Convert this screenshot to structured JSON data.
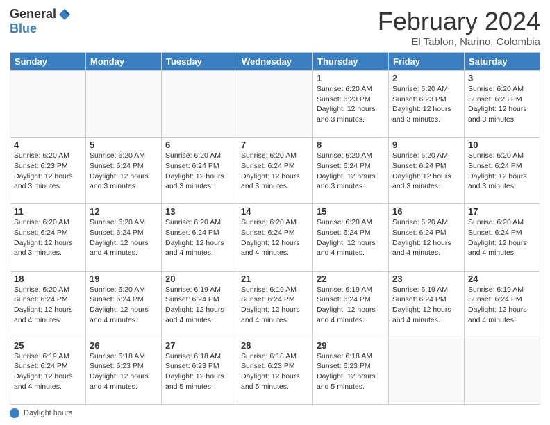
{
  "header": {
    "logo_general": "General",
    "logo_blue": "Blue",
    "month_title": "February 2024",
    "location": "El Tablon, Narino, Colombia"
  },
  "days_of_week": [
    "Sunday",
    "Monday",
    "Tuesday",
    "Wednesday",
    "Thursday",
    "Friday",
    "Saturday"
  ],
  "footer": {
    "label": "Daylight hours"
  },
  "weeks": [
    [
      {
        "num": "",
        "info": ""
      },
      {
        "num": "",
        "info": ""
      },
      {
        "num": "",
        "info": ""
      },
      {
        "num": "",
        "info": ""
      },
      {
        "num": "1",
        "info": "Sunrise: 6:20 AM\nSunset: 6:23 PM\nDaylight: 12 hours\nand 3 minutes."
      },
      {
        "num": "2",
        "info": "Sunrise: 6:20 AM\nSunset: 6:23 PM\nDaylight: 12 hours\nand 3 minutes."
      },
      {
        "num": "3",
        "info": "Sunrise: 6:20 AM\nSunset: 6:23 PM\nDaylight: 12 hours\nand 3 minutes."
      }
    ],
    [
      {
        "num": "4",
        "info": "Sunrise: 6:20 AM\nSunset: 6:23 PM\nDaylight: 12 hours\nand 3 minutes."
      },
      {
        "num": "5",
        "info": "Sunrise: 6:20 AM\nSunset: 6:24 PM\nDaylight: 12 hours\nand 3 minutes."
      },
      {
        "num": "6",
        "info": "Sunrise: 6:20 AM\nSunset: 6:24 PM\nDaylight: 12 hours\nand 3 minutes."
      },
      {
        "num": "7",
        "info": "Sunrise: 6:20 AM\nSunset: 6:24 PM\nDaylight: 12 hours\nand 3 minutes."
      },
      {
        "num": "8",
        "info": "Sunrise: 6:20 AM\nSunset: 6:24 PM\nDaylight: 12 hours\nand 3 minutes."
      },
      {
        "num": "9",
        "info": "Sunrise: 6:20 AM\nSunset: 6:24 PM\nDaylight: 12 hours\nand 3 minutes."
      },
      {
        "num": "10",
        "info": "Sunrise: 6:20 AM\nSunset: 6:24 PM\nDaylight: 12 hours\nand 3 minutes."
      }
    ],
    [
      {
        "num": "11",
        "info": "Sunrise: 6:20 AM\nSunset: 6:24 PM\nDaylight: 12 hours\nand 3 minutes."
      },
      {
        "num": "12",
        "info": "Sunrise: 6:20 AM\nSunset: 6:24 PM\nDaylight: 12 hours\nand 4 minutes."
      },
      {
        "num": "13",
        "info": "Sunrise: 6:20 AM\nSunset: 6:24 PM\nDaylight: 12 hours\nand 4 minutes."
      },
      {
        "num": "14",
        "info": "Sunrise: 6:20 AM\nSunset: 6:24 PM\nDaylight: 12 hours\nand 4 minutes."
      },
      {
        "num": "15",
        "info": "Sunrise: 6:20 AM\nSunset: 6:24 PM\nDaylight: 12 hours\nand 4 minutes."
      },
      {
        "num": "16",
        "info": "Sunrise: 6:20 AM\nSunset: 6:24 PM\nDaylight: 12 hours\nand 4 minutes."
      },
      {
        "num": "17",
        "info": "Sunrise: 6:20 AM\nSunset: 6:24 PM\nDaylight: 12 hours\nand 4 minutes."
      }
    ],
    [
      {
        "num": "18",
        "info": "Sunrise: 6:20 AM\nSunset: 6:24 PM\nDaylight: 12 hours\nand 4 minutes."
      },
      {
        "num": "19",
        "info": "Sunrise: 6:20 AM\nSunset: 6:24 PM\nDaylight: 12 hours\nand 4 minutes."
      },
      {
        "num": "20",
        "info": "Sunrise: 6:19 AM\nSunset: 6:24 PM\nDaylight: 12 hours\nand 4 minutes."
      },
      {
        "num": "21",
        "info": "Sunrise: 6:19 AM\nSunset: 6:24 PM\nDaylight: 12 hours\nand 4 minutes."
      },
      {
        "num": "22",
        "info": "Sunrise: 6:19 AM\nSunset: 6:24 PM\nDaylight: 12 hours\nand 4 minutes."
      },
      {
        "num": "23",
        "info": "Sunrise: 6:19 AM\nSunset: 6:24 PM\nDaylight: 12 hours\nand 4 minutes."
      },
      {
        "num": "24",
        "info": "Sunrise: 6:19 AM\nSunset: 6:24 PM\nDaylight: 12 hours\nand 4 minutes."
      }
    ],
    [
      {
        "num": "25",
        "info": "Sunrise: 6:19 AM\nSunset: 6:24 PM\nDaylight: 12 hours\nand 4 minutes."
      },
      {
        "num": "26",
        "info": "Sunrise: 6:18 AM\nSunset: 6:23 PM\nDaylight: 12 hours\nand 4 minutes."
      },
      {
        "num": "27",
        "info": "Sunrise: 6:18 AM\nSunset: 6:23 PM\nDaylight: 12 hours\nand 5 minutes."
      },
      {
        "num": "28",
        "info": "Sunrise: 6:18 AM\nSunset: 6:23 PM\nDaylight: 12 hours\nand 5 minutes."
      },
      {
        "num": "29",
        "info": "Sunrise: 6:18 AM\nSunset: 6:23 PM\nDaylight: 12 hours\nand 5 minutes."
      },
      {
        "num": "",
        "info": ""
      },
      {
        "num": "",
        "info": ""
      }
    ]
  ]
}
